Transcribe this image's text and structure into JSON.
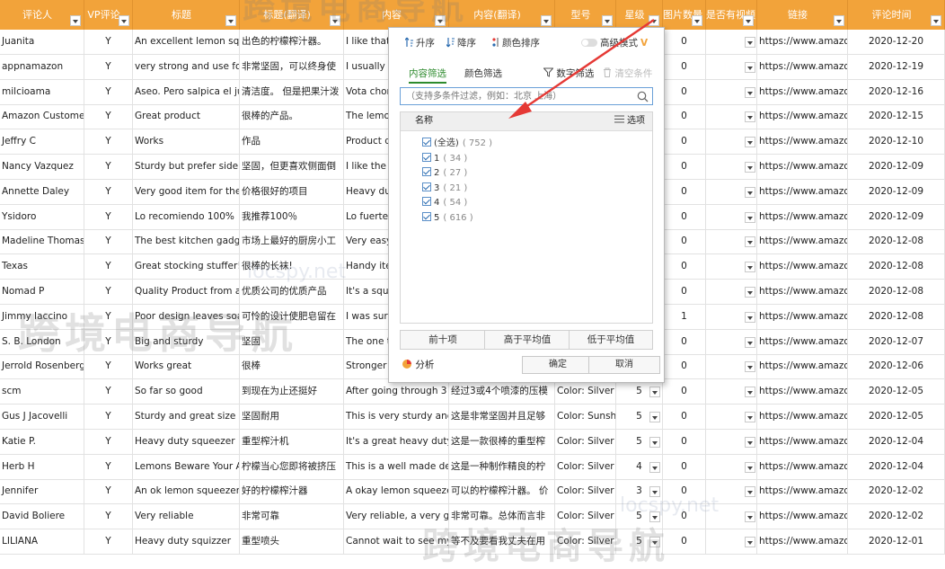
{
  "columns": [
    "评论人",
    "VP评论",
    "标题",
    "标题(翻译)",
    "内容",
    "内容(翻译)",
    "型号",
    "星级",
    "图片数量",
    "是否有视频",
    "链接",
    "评论时间"
  ],
  "rows": [
    {
      "reviewer": "Juanita",
      "vp": "Y",
      "title": "An excellent lemon squ",
      "title_tr": "出色的柠檬榨汁器。",
      "content": "I like that",
      "content_tr": "",
      "model": "",
      "stars": "",
      "images": "0",
      "link": "https://www.amazo",
      "date": "2020-12-20"
    },
    {
      "reviewer": "appnamazon",
      "vp": "Y",
      "title": "very strong and use for",
      "title_tr": "非常坚固，可以终身使",
      "content": "I usually s",
      "content_tr": "",
      "model": "",
      "stars": "",
      "images": "0",
      "link": "https://www.amazo",
      "date": "2020-12-19"
    },
    {
      "reviewer": "milcioama",
      "vp": "Y",
      "title": "Aseo. Pero salpica el jug",
      "title_tr": "清洁度。 但是把果汁泼",
      "content": "Vota chor",
      "content_tr": "",
      "model": "",
      "stars": "",
      "images": "0",
      "link": "https://www.amazo",
      "date": "2020-12-16"
    },
    {
      "reviewer": "Amazon Customer",
      "vp": "Y",
      "title": "Great product",
      "title_tr": "很棒的产品。",
      "content": "The lemo",
      "content_tr": "",
      "model": "",
      "stars": "",
      "images": "0",
      "link": "https://www.amazo",
      "date": "2020-12-15"
    },
    {
      "reviewer": "Jeffry C",
      "vp": "Y",
      "title": "Works",
      "title_tr": "作品",
      "content": "Product d",
      "content_tr": "",
      "model": "",
      "stars": "",
      "images": "0",
      "link": "https://www.amazo",
      "date": "2020-12-10"
    },
    {
      "reviewer": "Nancy Vazquez",
      "vp": "Y",
      "title": "Sturdy but prefer side p",
      "title_tr": "坚固，但更喜欢侧面倒",
      "content": "I like the",
      "content_tr": "",
      "model": "",
      "stars": "",
      "images": "0",
      "link": "https://www.amazo",
      "date": "2020-12-09"
    },
    {
      "reviewer": "Annette Daley",
      "vp": "Y",
      "title": "Very good item for the",
      "title_tr": "价格很好的项目",
      "content": "Heavy du",
      "content_tr": "",
      "model": "",
      "stars": "",
      "images": "0",
      "link": "https://www.amazo",
      "date": "2020-12-09"
    },
    {
      "reviewer": "Ysidoro",
      "vp": "Y",
      "title": "Lo recomiendo 100%",
      "title_tr": "我推荐100％",
      "content": "Lo fuerte",
      "content_tr": "",
      "model": "",
      "stars": "",
      "images": "0",
      "link": "https://www.amazo",
      "date": "2020-12-09"
    },
    {
      "reviewer": "Madeline  Thomas",
      "vp": "Y",
      "title": "The best kitchen gadge",
      "title_tr": "市场上最好的厨房小工",
      "content": "Very easy",
      "content_tr": "",
      "model": "",
      "stars": "",
      "images": "0",
      "link": "https://www.amazo",
      "date": "2020-12-08"
    },
    {
      "reviewer": "Texas",
      "vp": "Y",
      "title": "Great stocking stuffer!",
      "title_tr": "很棒的长袜!",
      "content": "Handy ite",
      "content_tr": "",
      "model": "",
      "stars": "",
      "images": "0",
      "link": "https://www.amazo",
      "date": "2020-12-08"
    },
    {
      "reviewer": "Nomad P",
      "vp": "Y",
      "title": "Quality Product from a",
      "title_tr": "优质公司的优质产品",
      "content": "It's a sque",
      "content_tr": "",
      "model": "",
      "stars": "",
      "images": "0",
      "link": "https://www.amazo",
      "date": "2020-12-08"
    },
    {
      "reviewer": "Jimmy Iaccino",
      "vp": "Y",
      "title": "Poor design leaves soap",
      "title_tr": "可怜的设计使肥皂留在",
      "content": "I was surp",
      "content_tr": "",
      "model": "",
      "stars": "",
      "images": "1",
      "link": "https://www.amazo",
      "date": "2020-12-08"
    },
    {
      "reviewer": "S. B. London",
      "vp": "Y",
      "title": "Big and sturdy",
      "title_tr": "坚固",
      "content": "The one t",
      "content_tr": "",
      "model": "",
      "stars": "",
      "images": "0",
      "link": "https://www.amazo",
      "date": "2020-12-07"
    },
    {
      "reviewer": "Jerrold Rosenberg",
      "vp": "Y",
      "title": "Works great",
      "title_tr": "很棒",
      "content": "Stronger",
      "content_tr": "",
      "model": "",
      "stars": "",
      "images": "0",
      "link": "https://www.amazo",
      "date": "2020-12-06"
    },
    {
      "reviewer": "scm",
      "vp": "Y",
      "title": "So far so good",
      "title_tr": "到现在为止还挺好",
      "content": "After going through 3 o",
      "content_tr": "经过3或4个喷漆的压模",
      "model": "Color: Silver",
      "stars": "5",
      "images": "0",
      "link": "https://www.amazo",
      "date": "2020-12-05"
    },
    {
      "reviewer": "Gus J Jacovelli",
      "vp": "Y",
      "title": "Sturdy and great size",
      "title_tr": "坚固耐用",
      "content": "This is very sturdy and b",
      "content_tr": "这是非常坚固并且足够",
      "model": "Color: Sunshir",
      "stars": "5",
      "images": "0",
      "link": "https://www.amazo",
      "date": "2020-12-05"
    },
    {
      "reviewer": "Katie P.",
      "vp": "Y",
      "title": "Heavy duty squeezer",
      "title_tr": "重型榨汁机",
      "content": "It's a great heavy duty s",
      "content_tr": "这是一款很棒的重型榨",
      "model": "Color: Silver",
      "stars": "5",
      "images": "0",
      "link": "https://www.amazo",
      "date": "2020-12-04"
    },
    {
      "reviewer": "Herb H",
      "vp": "Y",
      "title": "Lemons Beware Your Al",
      "title_tr": "柠檬当心您即将被挤压",
      "content": "This is a well made dev",
      "content_tr": "这是一种制作精良的柠",
      "model": "Color: Silver",
      "stars": "4",
      "images": "0",
      "link": "https://www.amazo",
      "date": "2020-12-04"
    },
    {
      "reviewer": "Jennifer",
      "vp": "Y",
      "title": "An ok lemon squeezer",
      "title_tr": "好的柠檬榨汁器",
      "content": "A okay lemon squeezer",
      "content_tr": "可以的柠檬榨汁器。 价",
      "model": "Color: Silver",
      "stars": "3",
      "images": "0",
      "link": "https://www.amazo",
      "date": "2020-12-02"
    },
    {
      "reviewer": "David Boliere",
      "vp": "Y",
      "title": "Very reliable",
      "title_tr": "非常可靠",
      "content": "Very reliable, a very go",
      "content_tr": "非常可靠。总体而言非",
      "model": "Color: Silver",
      "stars": "5",
      "images": "0",
      "link": "https://www.amazo",
      "date": "2020-12-02"
    },
    {
      "reviewer": "LILIANA",
      "vp": "Y",
      "title": "Heavy duty squizzer",
      "title_tr": "重型喷头",
      "content": "Cannot wait to see my l",
      "content_tr": "等不及要看我丈夫在用",
      "model": "Color: Silver",
      "stars": "5",
      "images": "0",
      "link": "https://www.amazo",
      "date": "2020-12-01"
    }
  ],
  "filter_popup": {
    "sort_asc": "升序",
    "sort_desc": "降序",
    "sort_color": "颜色排序",
    "advanced_mode": "高级模式",
    "tab_content": "内容筛选",
    "tab_color": "颜色筛选",
    "number_filter": "数字筛选",
    "clear_filter": "清空条件",
    "search_placeholder": "（支持多条件过滤，例如：北京 上海）",
    "list_header": "名称",
    "options_label": "选项",
    "items": [
      {
        "label": "(全选)",
        "count": "( 752 )"
      },
      {
        "label": "1",
        "count": "( 34 )"
      },
      {
        "label": "2",
        "count": "( 27 )"
      },
      {
        "label": "3",
        "count": "( 21 )"
      },
      {
        "label": "4",
        "count": "( 54 )"
      },
      {
        "label": "5",
        "count": "( 616 )"
      }
    ],
    "top_ten": "前十项",
    "above_avg": "高于平均值",
    "below_avg": "低于平均值",
    "analysis": "分析",
    "ok": "确定",
    "cancel": "取消"
  },
  "watermark": {
    "main_text": "跨境电商导航",
    "url_text": "locspy.net"
  },
  "colors": {
    "header_bg": "#f2a33a",
    "accent_green": "#2e8b2e",
    "arrow_red": "#e53935",
    "checkbox_blue": "#2b6cb0"
  }
}
